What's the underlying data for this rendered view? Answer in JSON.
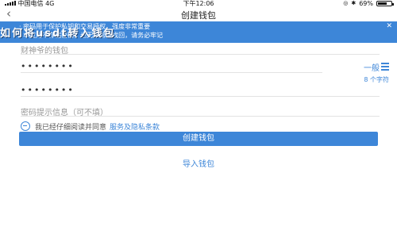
{
  "status_bar": {
    "carrier": "中国电信",
    "network": "4G",
    "time": "下午12:06",
    "battery": "69%",
    "battery_level": 0.69
  },
  "nav": {
    "back_icon": "chevron-left-icon",
    "title": "创建钱包"
  },
  "banner": {
    "line1": "· 密码用于保护私钥和交易授权，强度非常重要",
    "line2": "· 本应用不存储密码，也无法帮您找回，请务必牢记",
    "overlay": "如何将usdt转入钱包",
    "close_icon": "close-icon"
  },
  "form": {
    "wallet_name_placeholder": "财神爷的钱包",
    "password_value": "••••••••",
    "password_strength": "一般",
    "password_hint_chars": "8 个字符",
    "repeat_password_value": "••••••••",
    "hint_placeholder": "密码提示信息（可不填）"
  },
  "agreement": {
    "text": "我已经仔细阅读并同意",
    "link": "服务及隐私条款"
  },
  "actions": {
    "create_label": "创建钱包",
    "import_label": "导入钱包"
  },
  "colors": {
    "accent": "#3d86d8"
  }
}
